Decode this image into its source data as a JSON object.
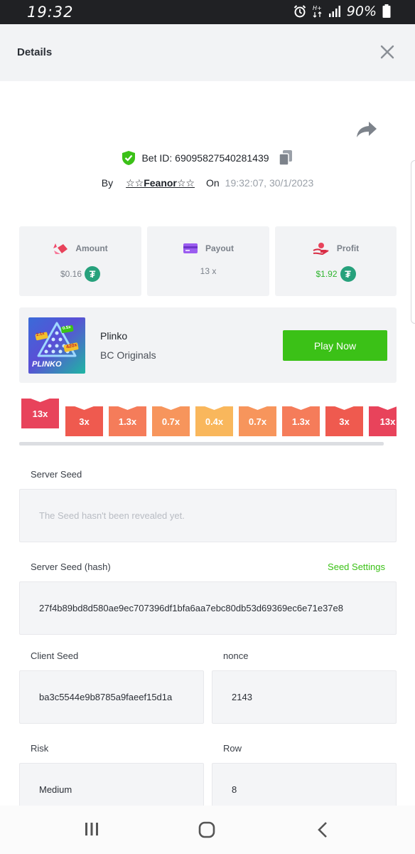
{
  "status_bar": {
    "time": "19:32",
    "battery": "90%"
  },
  "header": {
    "title": "Details"
  },
  "bet": {
    "id_text": "Bet ID: 69095827540281439",
    "by_label": "By",
    "user": "☆☆Feanor☆☆",
    "on_label": "On",
    "time": "19:32:07, 30/1/2023"
  },
  "stats": {
    "amount": {
      "label": "Amount",
      "value": "$0.16"
    },
    "payout": {
      "label": "Payout",
      "value": "13 x"
    },
    "profit": {
      "label": "Profit",
      "value": "$1.92"
    }
  },
  "game": {
    "name": "Plinko",
    "provider": "BC Originals",
    "play_label": "Play Now",
    "thumb_text": "PLINKO",
    "thumb_badges": [
      "2.1x",
      "0.5x",
      "420x"
    ]
  },
  "multipliers": [
    {
      "label": "13x",
      "color": "#e8435b",
      "active": true
    },
    {
      "label": "3x",
      "color": "#ef5a4f"
    },
    {
      "label": "1.3x",
      "color": "#f57c5a"
    },
    {
      "label": "0.7x",
      "color": "#f7955c"
    },
    {
      "label": "0.4x",
      "color": "#f9b75c"
    },
    {
      "label": "0.7x",
      "color": "#f7955c"
    },
    {
      "label": "1.3x",
      "color": "#f57c5a"
    },
    {
      "label": "3x",
      "color": "#ef5a4f"
    },
    {
      "label": "13x",
      "color": "#e8435b"
    }
  ],
  "server_seed": {
    "label": "Server Seed",
    "placeholder": "The Seed hasn't been revealed yet."
  },
  "server_seed_hash": {
    "label": "Server Seed (hash)",
    "settings_label": "Seed Settings",
    "value": "27f4b89bd8d580ae9ec707396df1bfa6aa7ebc80db53d69369ec6e71e37e8"
  },
  "client_seed": {
    "label": "Client Seed",
    "value": "ba3c5544e9b8785a9faeef15d1a"
  },
  "nonce": {
    "label": "nonce",
    "value": "2143"
  },
  "risk": {
    "label": "Risk",
    "value": "Medium"
  },
  "row": {
    "label": "Row",
    "value": "8"
  },
  "colors": {
    "accent_green": "#3bc117",
    "tether_green": "#27a17c",
    "header_bg": "#f2f3f5"
  }
}
